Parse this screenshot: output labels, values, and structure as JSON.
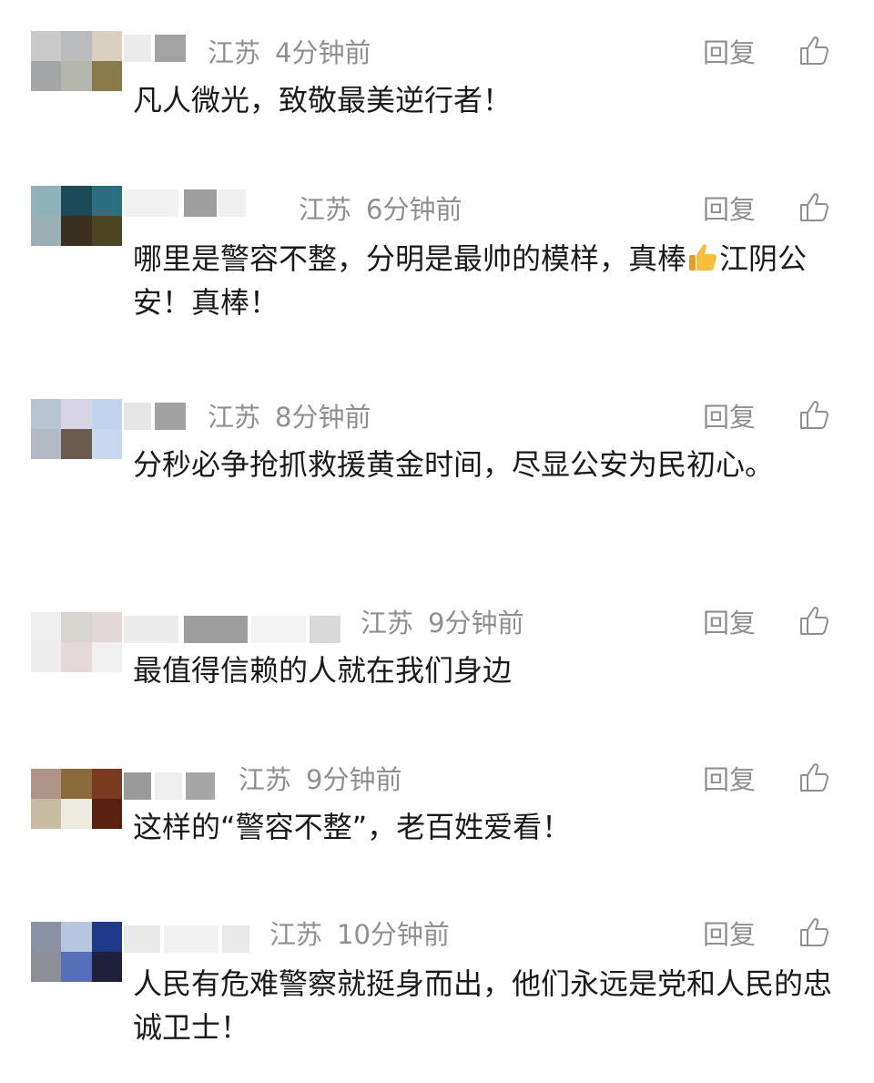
{
  "comments": [
    {
      "location": "江苏",
      "time": "4分钟前",
      "reply_label": "回复",
      "text": "凡人微光，致敬最美逆行者！"
    },
    {
      "location": "江苏",
      "time": "6分钟前",
      "reply_label": "回复",
      "text_before_emoji": "哪里是警容不整，分明是最帅的模样，真棒",
      "emoji": "thumbs-up-emoji",
      "text_after_emoji": "江阴公安！真棒！"
    },
    {
      "location": "江苏",
      "time": "8分钟前",
      "reply_label": "回复",
      "text": "分秒必争抢抓救援黄金时间，尽显公安为民初心。"
    },
    {
      "location": "江苏",
      "time": "9分钟前",
      "reply_label": "回复",
      "text": "最值得信赖的人就在我们身边"
    },
    {
      "location": "江苏",
      "time": "9分钟前",
      "reply_label": "回复",
      "text": "这样的“警容不整”，老百姓爱看！"
    },
    {
      "location": "江苏",
      "time": "10分钟前",
      "reply_label": "回复",
      "text": "人民有危难警察就挺身而出，他们永远是党和人民的忠诚卫士！"
    }
  ],
  "icons": {
    "like": "thumbs-up-outline-icon",
    "emoji": "thumbs-up-emoji"
  },
  "colors": {
    "meta_text": "#8f8f8f",
    "body_text": "#1a1a1a",
    "background": "#ffffff"
  }
}
